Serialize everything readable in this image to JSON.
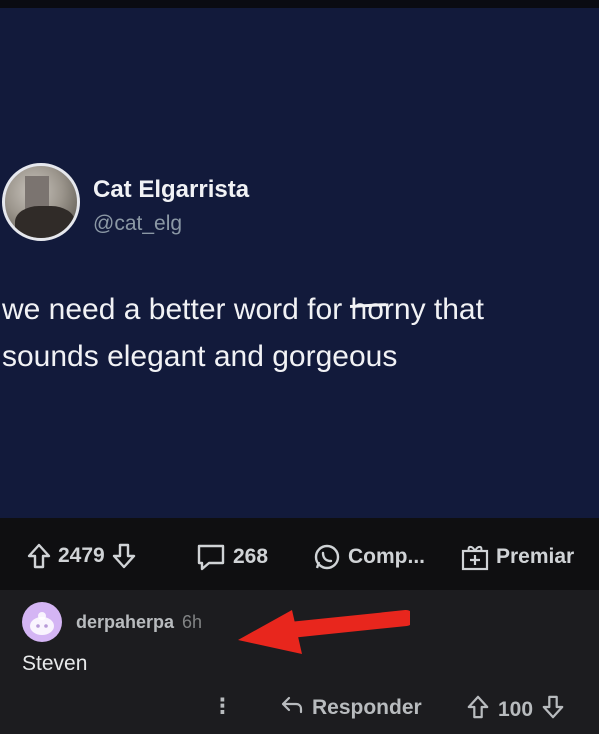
{
  "tweet": {
    "author_name": "Cat Elgarrista",
    "author_handle": "@cat_elg",
    "text_part1": "we need a better word for ",
    "text_struck": "ho",
    "text_part2": "rny that",
    "text_line2": "sounds elegant and gorgeous"
  },
  "post_actions": {
    "upvotes": "2479",
    "comments": "268",
    "share_label": "Comp...",
    "award_label": "Premiar"
  },
  "comment": {
    "username": "derpaherpa",
    "time": "6h",
    "body": "Steven",
    "more_label": "⋮",
    "reply_label": "Responder",
    "score": "100"
  },
  "colors": {
    "tweet_bg": "#121a3b",
    "comment_bg": "#1c1c1f",
    "arrow": "#e8261d",
    "avatar_bg": "#d4b5f4"
  },
  "icons": [
    "upvote-icon",
    "downvote-icon",
    "comment-icon",
    "whatsapp-icon",
    "award-icon",
    "reply-icon",
    "more-options-icon"
  ]
}
